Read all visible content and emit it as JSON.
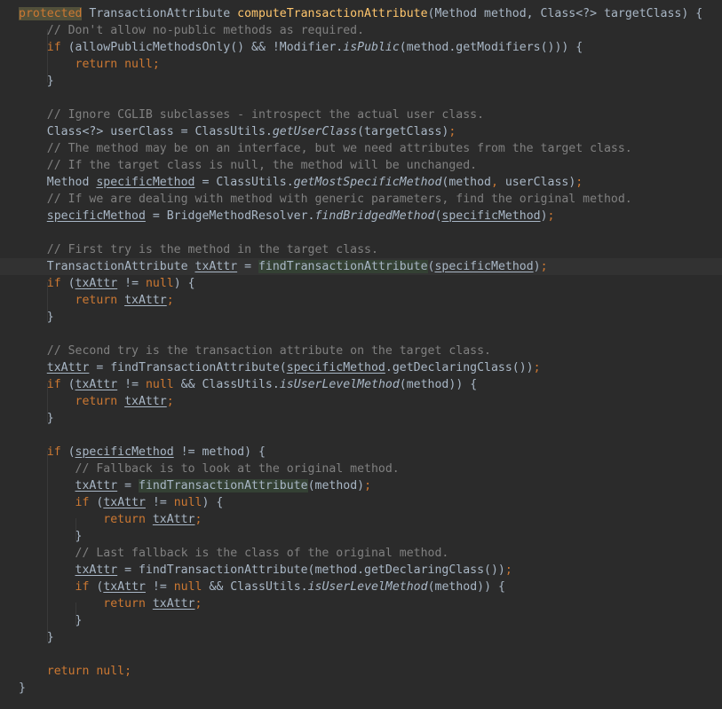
{
  "lines": [
    [
      [
        "prot",
        "protected"
      ],
      [
        "plain",
        " TransactionAttribute "
      ],
      [
        "fn",
        "computeTransactionAttribute"
      ],
      [
        "plain",
        "(Method method, Class<?> targetClass) {"
      ]
    ],
    [
      [
        "plain",
        "    "
      ],
      [
        "cm",
        "// Don't allow no-public methods as required."
      ]
    ],
    [
      [
        "plain",
        "    "
      ],
      [
        "kw",
        "if"
      ],
      [
        "plain",
        " (allowPublicMethodsOnly() && !Modifier."
      ],
      [
        "it",
        "isPublic"
      ],
      [
        "plain",
        "(method.getModifiers())) {"
      ]
    ],
    [
      [
        "plain",
        "        "
      ],
      [
        "kw",
        "return null"
      ],
      [
        "kw",
        ";"
      ]
    ],
    [
      [
        "plain",
        "    }"
      ]
    ],
    [],
    [
      [
        "plain",
        "    "
      ],
      [
        "cm",
        "// Ignore CGLIB subclasses - introspect the actual user class."
      ]
    ],
    [
      [
        "plain",
        "    Class<?> userClass = ClassUtils."
      ],
      [
        "it",
        "getUserClass"
      ],
      [
        "plain",
        "(targetClass)"
      ],
      [
        "kw",
        ";"
      ]
    ],
    [
      [
        "plain",
        "    "
      ],
      [
        "cm",
        "// The method may be on an interface, but we need attributes from the target class."
      ]
    ],
    [
      [
        "plain",
        "    "
      ],
      [
        "cm",
        "// If the target class is null, the method will be unchanged."
      ]
    ],
    [
      [
        "plain",
        "    Method "
      ],
      [
        "ul",
        "specificMethod"
      ],
      [
        "plain",
        " = ClassUtils."
      ],
      [
        "it",
        "getMostSpecificMethod"
      ],
      [
        "plain",
        "(method"
      ],
      [
        "kw",
        ","
      ],
      [
        "plain",
        " userClass)"
      ],
      [
        "kw",
        ";"
      ]
    ],
    [
      [
        "plain",
        "    "
      ],
      [
        "cm",
        "// If we are dealing with method with generic parameters, find the original method."
      ]
    ],
    [
      [
        "plain",
        "    "
      ],
      [
        "ul",
        "specificMethod"
      ],
      [
        "plain",
        " = BridgeMethodResolver."
      ],
      [
        "it",
        "findBridgedMethod"
      ],
      [
        "plain",
        "("
      ],
      [
        "ul",
        "specificMethod"
      ],
      [
        "plain",
        ")"
      ],
      [
        "kw",
        ";"
      ]
    ],
    [],
    [
      [
        "plain",
        "    "
      ],
      [
        "cm",
        "// First try is the method in the target class."
      ]
    ],
    [
      [
        "plain",
        "    TransactionAttribute "
      ],
      [
        "ul",
        "txAttr"
      ],
      [
        "plain",
        " = "
      ],
      [
        "caret",
        ""
      ],
      [
        "hl",
        "findTransactionAttribute"
      ],
      [
        "plain",
        "("
      ],
      [
        "ul",
        "specificMethod"
      ],
      [
        "plain",
        ")"
      ],
      [
        "kw",
        ";"
      ]
    ],
    [
      [
        "plain",
        "    "
      ],
      [
        "kw",
        "if"
      ],
      [
        "plain",
        " ("
      ],
      [
        "ul",
        "txAttr"
      ],
      [
        "plain",
        " != "
      ],
      [
        "kw",
        "null"
      ],
      [
        "plain",
        ") {"
      ]
    ],
    [
      [
        "plain",
        "        "
      ],
      [
        "kw",
        "return "
      ],
      [
        "ul",
        "txAttr"
      ],
      [
        "kw",
        ";"
      ]
    ],
    [
      [
        "plain",
        "    }"
      ]
    ],
    [],
    [
      [
        "plain",
        "    "
      ],
      [
        "cm",
        "// Second try is the transaction attribute on the target class."
      ]
    ],
    [
      [
        "plain",
        "    "
      ],
      [
        "ul",
        "txAttr"
      ],
      [
        "plain",
        " = findTransactionAttribute("
      ],
      [
        "ul",
        "specificMethod"
      ],
      [
        "plain",
        ".getDeclaringClass())"
      ],
      [
        "kw",
        ";"
      ]
    ],
    [
      [
        "plain",
        "    "
      ],
      [
        "kw",
        "if"
      ],
      [
        "plain",
        " ("
      ],
      [
        "ul",
        "txAttr"
      ],
      [
        "plain",
        " != "
      ],
      [
        "kw",
        "null"
      ],
      [
        "plain",
        " && ClassUtils."
      ],
      [
        "it",
        "isUserLevelMethod"
      ],
      [
        "plain",
        "(method)) {"
      ]
    ],
    [
      [
        "plain",
        "        "
      ],
      [
        "kw",
        "return "
      ],
      [
        "ul",
        "txAttr"
      ],
      [
        "kw",
        ";"
      ]
    ],
    [
      [
        "plain",
        "    }"
      ]
    ],
    [],
    [
      [
        "plain",
        "    "
      ],
      [
        "kw",
        "if"
      ],
      [
        "plain",
        " ("
      ],
      [
        "ul",
        "specificMethod"
      ],
      [
        "plain",
        " != method) {"
      ]
    ],
    [
      [
        "plain",
        "        "
      ],
      [
        "cm",
        "// Fallback is to look at the original method."
      ]
    ],
    [
      [
        "plain",
        "        "
      ],
      [
        "ul",
        "txAttr"
      ],
      [
        "plain",
        " = "
      ],
      [
        "hl",
        "findTransactionAttribute"
      ],
      [
        "plain",
        "(method)"
      ],
      [
        "kw",
        ";"
      ]
    ],
    [
      [
        "plain",
        "        "
      ],
      [
        "kw",
        "if"
      ],
      [
        "plain",
        " ("
      ],
      [
        "ul",
        "txAttr"
      ],
      [
        "plain",
        " != "
      ],
      [
        "kw",
        "null"
      ],
      [
        "plain",
        ") {"
      ]
    ],
    [
      [
        "plain",
        "            "
      ],
      [
        "kw",
        "return "
      ],
      [
        "ul",
        "txAttr"
      ],
      [
        "kw",
        ";"
      ]
    ],
    [
      [
        "plain",
        "        }"
      ]
    ],
    [
      [
        "plain",
        "        "
      ],
      [
        "cm",
        "// Last fallback is the class of the original method."
      ]
    ],
    [
      [
        "plain",
        "        "
      ],
      [
        "ul",
        "txAttr"
      ],
      [
        "plain",
        " = findTransactionAttribute(method.getDeclaringClass())"
      ],
      [
        "kw",
        ";"
      ]
    ],
    [
      [
        "plain",
        "        "
      ],
      [
        "kw",
        "if"
      ],
      [
        "plain",
        " ("
      ],
      [
        "ul",
        "txAttr"
      ],
      [
        "plain",
        " != "
      ],
      [
        "kw",
        "null"
      ],
      [
        "plain",
        " && ClassUtils."
      ],
      [
        "it",
        "isUserLevelMethod"
      ],
      [
        "plain",
        "(method)) {"
      ]
    ],
    [
      [
        "plain",
        "            "
      ],
      [
        "kw",
        "return "
      ],
      [
        "ul",
        "txAttr"
      ],
      [
        "kw",
        ";"
      ]
    ],
    [
      [
        "plain",
        "        }"
      ]
    ],
    [
      [
        "plain",
        "    }"
      ]
    ],
    [],
    [
      [
        "plain",
        "    "
      ],
      [
        "kw",
        "return null"
      ],
      [
        "kw",
        ";"
      ]
    ],
    [
      [
        "plain",
        "}"
      ]
    ]
  ],
  "current_line_index": 15,
  "colors": {
    "background": "#2b2b2b",
    "current_line": "#323232",
    "keyword": "#cc7832",
    "comment": "#808080",
    "method_declaration": "#ffc66d",
    "identifier": "#a9b7c6",
    "usage_highlight": "#344134",
    "protected_highlight": "#52503a"
  }
}
